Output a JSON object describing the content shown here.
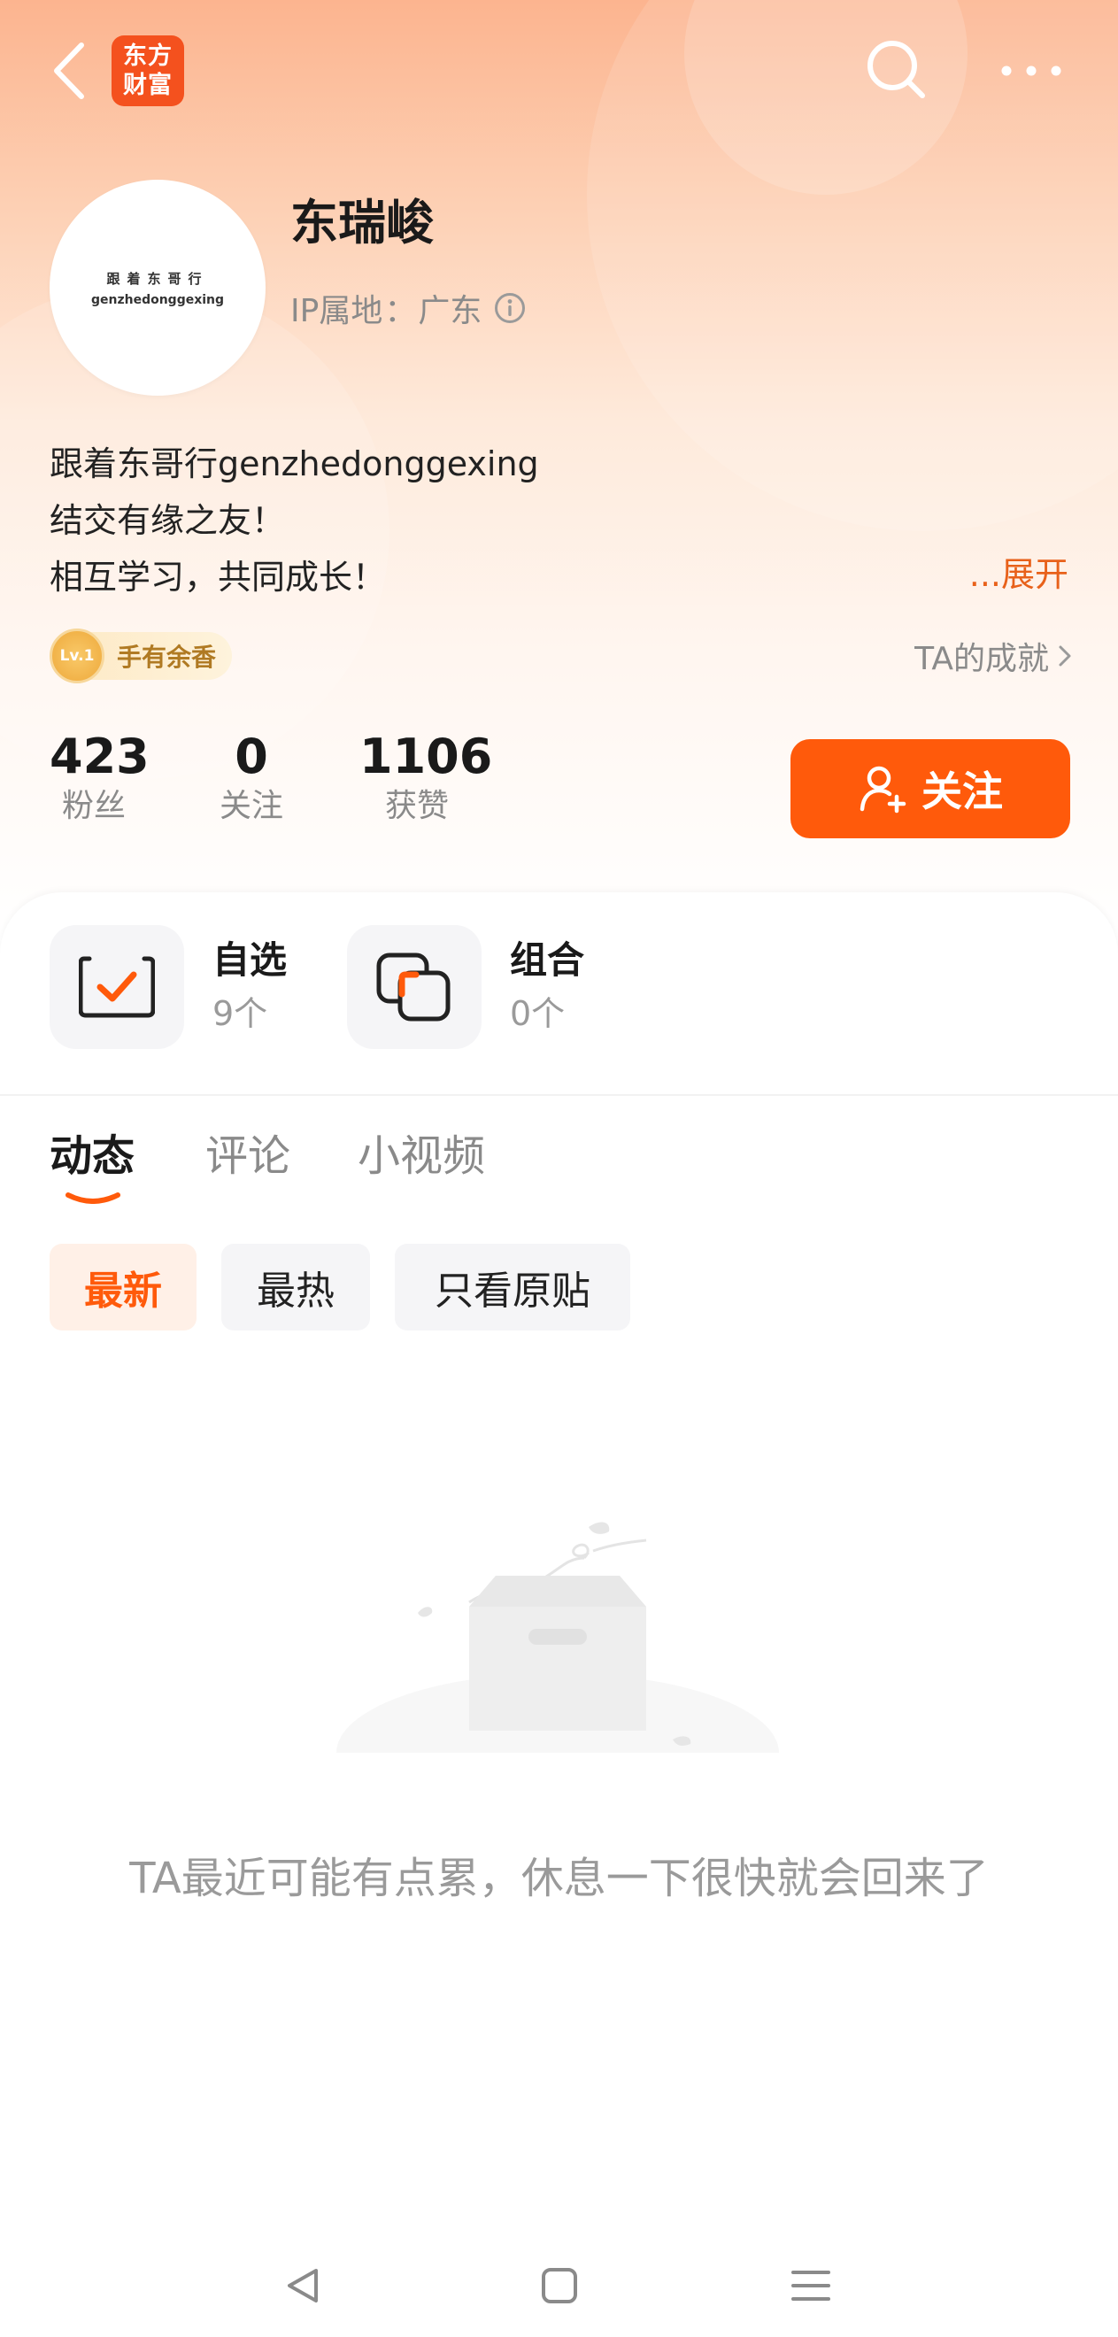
{
  "header": {
    "logo_line1": "东方",
    "logo_line2": "财富",
    "back_icon": "chevron-left-icon",
    "search_icon": "search-icon",
    "more_icon": "more-dots-icon"
  },
  "profile": {
    "avatar_line1": "跟着东哥行",
    "avatar_line2": "genzhedonggexing",
    "name": "东瑞峻",
    "ip_label": "IP属地",
    "ip_sep": "：",
    "ip_value": "广东",
    "bio_lines": [
      "跟着东哥行genzhedonggexing",
      "结交有缘之友！",
      "相互学习，共同成长！"
    ],
    "expand": "...展开",
    "badge_level": "Lv.1",
    "badge_text": "手有余香",
    "achievement_link": "TA的成就"
  },
  "stats": [
    {
      "value": "423",
      "label": "粉丝"
    },
    {
      "value": "0",
      "label": "关注"
    },
    {
      "value": "1106",
      "label": "获赞"
    }
  ],
  "follow_button": "关注",
  "watchlist": [
    {
      "title": "自选",
      "count": "9个"
    },
    {
      "title": "组合",
      "count": "0个"
    }
  ],
  "tabs": [
    {
      "label": "动态",
      "active": true
    },
    {
      "label": "评论",
      "active": false
    },
    {
      "label": "小视频",
      "active": false
    }
  ],
  "filters": [
    {
      "label": "最新",
      "active": true
    },
    {
      "label": "最热",
      "active": false
    },
    {
      "label": "只看原贴",
      "active": false
    }
  ],
  "empty_state": "TA最近可能有点累，休息一下很快就会回来了",
  "colors": {
    "accent": "#ff5a0b",
    "accent_text": "#e8611a",
    "secondary_text": "#8a8a8a"
  }
}
